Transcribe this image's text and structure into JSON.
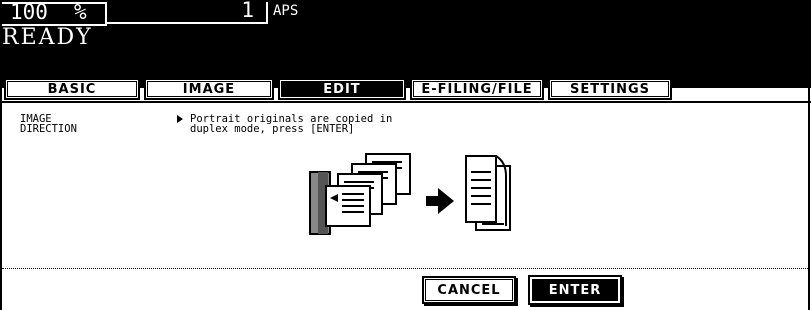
{
  "header": {
    "zoom_value": "100",
    "zoom_unit": "%",
    "copy_count": "1",
    "paper_size": "APS",
    "status": "READY"
  },
  "tabs": [
    {
      "label": "BASIC",
      "active": false
    },
    {
      "label": "IMAGE",
      "active": false
    },
    {
      "label": "EDIT",
      "active": true
    },
    {
      "label": "E-FILING/FILE",
      "active": false
    },
    {
      "label": "SETTINGS",
      "active": false
    }
  ],
  "panel": {
    "function_title_line1": "IMAGE",
    "function_title_line2": "DIRECTION",
    "message_line1": "Portrait originals are copied in",
    "message_line2": "duplex mode, press [ENTER]"
  },
  "buttons": {
    "cancel": "CANCEL",
    "enter": "ENTER"
  }
}
